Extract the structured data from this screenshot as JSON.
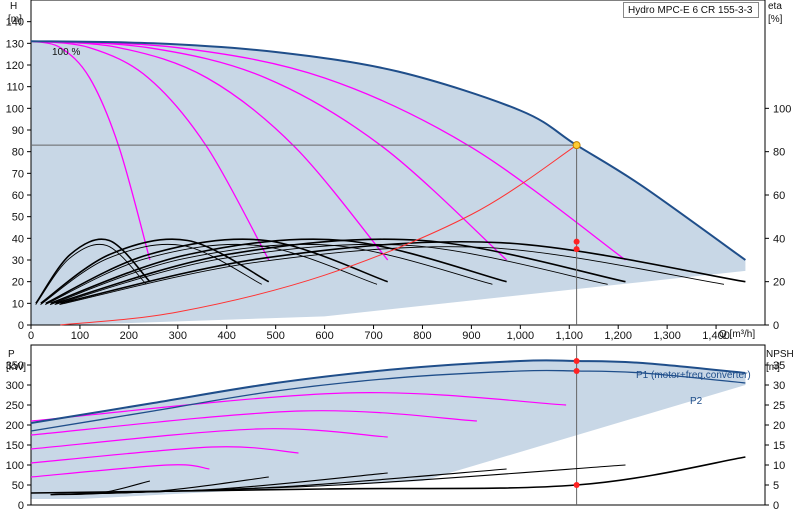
{
  "title": "Hydro MPC-E 6 CR 155-3-3",
  "colors": {
    "envelope_fill": "#c8d7e6",
    "envelope_line": "#1f4e8a",
    "curve_magenta": "#ff00ff",
    "curve_black": "#000000",
    "system_curve": "#ff3333",
    "op_line": "#666666",
    "duty_point": "#ffcc33",
    "marker_red": "#ff2222"
  },
  "chart_data": [
    {
      "type": "line",
      "name": "head",
      "ylabel": "H",
      "yunit": "[m]",
      "y2label": "eta",
      "y2unit": "[%]",
      "xunit": "Q [m³/h]",
      "xlim": [
        0,
        1500
      ],
      "ylim": [
        0,
        150
      ],
      "y2lim": [
        0,
        150
      ],
      "xticks": [
        0,
        100,
        200,
        300,
        400,
        500,
        600,
        700,
        800,
        900,
        1000,
        1100,
        1200,
        1300,
        1400
      ],
      "xtick_labels": [
        "0",
        "100",
        "200",
        "300",
        "400",
        "500",
        "600",
        "700",
        "800",
        "900",
        "1,000",
        "1,100",
        "1,200",
        "1,300",
        "1,400"
      ],
      "yticks": [
        0,
        10,
        20,
        30,
        40,
        50,
        60,
        70,
        80,
        90,
        100,
        110,
        120,
        130,
        140
      ],
      "y2ticks": [
        0,
        20,
        40,
        60,
        80,
        100
      ],
      "annotation": "100 %",
      "duty_point": {
        "Q": 1115,
        "H": 83
      },
      "envelope": {
        "Q": [
          0,
          250,
          500,
          750,
          1000,
          1115,
          1250,
          1460
        ],
        "H": [
          131,
          130,
          126,
          117,
          99,
          83,
          64,
          30
        ]
      },
      "pump_max_curves": [
        {
          "pumps": 1,
          "Q": [
            0,
            60,
            120,
            180,
            243
          ],
          "H": [
            131,
            128,
            114,
            82,
            30
          ]
        },
        {
          "pumps": 2,
          "Q": [
            0,
            120,
            240,
            360,
            486
          ],
          "H": [
            131,
            128,
            114,
            82,
            30
          ]
        },
        {
          "pumps": 3,
          "Q": [
            0,
            180,
            360,
            540,
            729
          ],
          "H": [
            131,
            128,
            114,
            82,
            30
          ]
        },
        {
          "pumps": 4,
          "Q": [
            0,
            240,
            480,
            720,
            972
          ],
          "H": [
            131,
            128,
            114,
            82,
            30
          ]
        },
        {
          "pumps": 5,
          "Q": [
            0,
            300,
            600,
            900,
            1215
          ],
          "H": [
            131,
            128,
            114,
            82,
            30
          ]
        }
      ],
      "system_curve": {
        "Q": [
          60,
          300,
          600,
          900,
          1115
        ],
        "H": [
          0,
          6,
          23,
          51,
          83
        ]
      },
      "efficiency_curves": [
        {
          "pumps": 1,
          "Q": [
            10,
            80,
            160,
            243
          ],
          "eta": [
            20,
            65,
            78,
            40
          ]
        },
        {
          "pumps": 2,
          "Q": [
            20,
            160,
            320,
            486
          ],
          "eta": [
            20,
            65,
            78,
            40
          ]
        },
        {
          "pumps": 3,
          "Q": [
            30,
            240,
            480,
            729
          ],
          "eta": [
            20,
            65,
            78,
            40
          ]
        },
        {
          "pumps": 4,
          "Q": [
            40,
            320,
            640,
            972
          ],
          "eta": [
            20,
            65,
            78,
            40
          ]
        },
        {
          "pumps": 5,
          "Q": [
            50,
            400,
            800,
            1215
          ],
          "eta": [
            20,
            65,
            78,
            40
          ]
        },
        {
          "pumps": 6,
          "Q": [
            60,
            480,
            960,
            1460
          ],
          "eta": [
            20,
            62,
            76,
            40
          ]
        }
      ],
      "markers": [
        {
          "Q": 1115,
          "eta": 77
        },
        {
          "Q": 1115,
          "eta": 70
        }
      ]
    },
    {
      "type": "line",
      "name": "power",
      "ylabel": "P",
      "yunit": "[kW]",
      "y2label": "NPSH",
      "y2unit": "[m]",
      "xlim": [
        0,
        1500
      ],
      "ylim": [
        0,
        400
      ],
      "y2lim": [
        0,
        40
      ],
      "yticks": [
        0,
        50,
        100,
        150,
        200,
        250,
        300,
        350
      ],
      "y2ticks": [
        0,
        5,
        10,
        15,
        20,
        25,
        30,
        35
      ],
      "series": [
        {
          "name": "P1 (motor+freq.converter)",
          "Q": [
            0,
            250,
            500,
            750,
            1000,
            1115,
            1250,
            1460
          ],
          "P": [
            205,
            255,
            305,
            340,
            360,
            360,
            355,
            330
          ]
        },
        {
          "name": "P2",
          "Q": [
            0,
            250,
            500,
            750,
            1000,
            1115,
            1250,
            1460
          ],
          "P": [
            185,
            235,
            285,
            318,
            335,
            335,
            330,
            305
          ]
        }
      ],
      "markers": [
        {
          "Q": 1115,
          "P": 360
        },
        {
          "Q": 1115,
          "P": 335
        },
        {
          "Q": 1115,
          "NPSH": 5
        }
      ]
    }
  ]
}
